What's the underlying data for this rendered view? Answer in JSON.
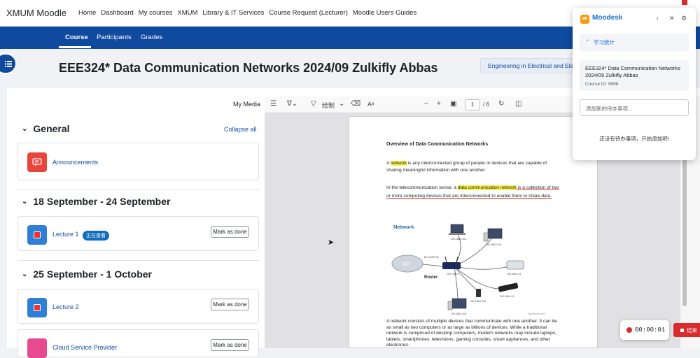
{
  "topnav": {
    "brand": "XMUM Moodle",
    "links": [
      "Home",
      "Dashboard",
      "My courses",
      "XMUM",
      "Library & IT Services",
      "Course Request (Lecturer)",
      "Moodle Users Guides"
    ]
  },
  "course_tabs": [
    "Course",
    "Participants",
    "Grades"
  ],
  "course": {
    "title": "EEE324* Data Communication Networks 2024/09 Zulkifly Abbas",
    "category_badge": "Engineering in Electrical and Elec"
  },
  "left": {
    "my_media": "My Media",
    "collapse_all": "Collapse all",
    "sections": [
      {
        "title": "General",
        "activities": [
          {
            "label": "Announcements"
          }
        ]
      },
      {
        "title": "18 September - 24 September",
        "activities": [
          {
            "label": "Lecture 1",
            "badge": "正在查看",
            "mark": "Mark as done"
          }
        ]
      },
      {
        "title": "25 September - 1 October",
        "activities": [
          {
            "label": "Lecture 2",
            "mark": "Mark as done"
          },
          {
            "label": "Cloud Service Provider",
            "mark": "Mark as done"
          }
        ]
      }
    ]
  },
  "pdf": {
    "draw_label": "绘制",
    "page_current": "1",
    "page_total": "/ 6",
    "doc": {
      "title": "Overview of Data Communication Networks",
      "p1_pre": "A ",
      "p1_hl": "network",
      "p1_post": " is any interconnected group of people or devices that are capable of sharing meaningful information with one another.",
      "p2_pre": "In the telecommunication sense, a ",
      "p2_hl": "data communication network",
      "p2_post": " is a collection of two or more computing devices that are interconnected to enable them to share data.",
      "p3": "A network consists of multiple devices that communicate with one another. It can be as small as two computers or as large as billions of devices. While a traditional network is comprised of desktop computers, modern networks may include laptops, tablets, smartphones, televisions, gaming consoles, smart appliances, and other electronics.",
      "diagram": {
        "title": "Network",
        "isp": "ISP",
        "router": "Router",
        "router_ip": "192.168.0.1",
        "public_ip": "82.15.250.78",
        "ips": [
          "192.168.0.101",
          "192.168.0.104",
          "192.168.0.11",
          "192.168.0.10",
          "192.168.0.100",
          "192.168.0.103"
        ],
        "footer": "TechTerms.com"
      }
    }
  },
  "moodesk": {
    "title": "Moodesk",
    "section_label": "学习统计",
    "course_name": "EEE324* Data Communication Networks 2024/09 Zulkifly Abbas",
    "course_id": "Course ID: 9998",
    "todo_placeholder": "添加新的待办事项...",
    "empty_text": "还没有待办事项，开始添加吧!"
  },
  "recorder": {
    "time": "00:00:01",
    "stop_label": "结束"
  },
  "colors": {
    "brand_blue": "#0f4a9e",
    "link_blue": "#0f6cbf",
    "moodesk_blue": "#1d6fd3",
    "announce_red": "#e8453c",
    "lecture_blue": "#2e7fd6",
    "highlight_yellow": "#f6f24a",
    "recorder_red": "#d92b2b"
  }
}
